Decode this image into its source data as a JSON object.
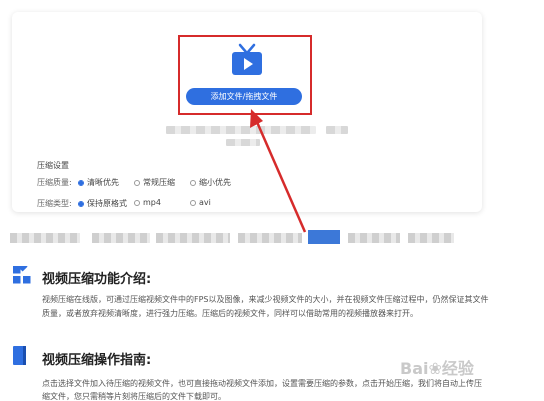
{
  "upload": {
    "button_label": "添加文件/拖拽文件",
    "icon": "tv-play-icon"
  },
  "settings": {
    "title": "压缩设置",
    "quality_label": "压缩质量:",
    "quality_options": [
      "清晰优先",
      "常规压缩",
      "缩小优先"
    ],
    "quality_selected": "清晰优先",
    "type_label": "压缩类型:",
    "type_options": [
      "保持原格式",
      "mp4",
      "avi"
    ],
    "type_selected": "保持原格式"
  },
  "intro": {
    "title": "视频压缩功能介绍:",
    "text_line1": "视频压缩在线版，可通过压缩视频文件中的FPS以及图像，来减少视频文件的大小，并在视频文件压缩过程中，仍然保证其文件",
    "text_line2": "质量，或者放弃视频清晰度，进行强力压缩。压缩后的视频文件，同样可以借助常用的视频播放器来打开。"
  },
  "guide": {
    "title": "视频压缩操作指南:",
    "text_line1": "点击选择文件加入待压缩的视频文件，也可直接拖动视频文件添加，设置需要压缩的参数，点击开始压缩，我们将自动上传压",
    "text_line2": "缩文件，您只需稍等片刻将压缩后的文件下载即可。"
  },
  "colors": {
    "accent": "#2f6fe0",
    "highlight": "#d62b2b"
  }
}
